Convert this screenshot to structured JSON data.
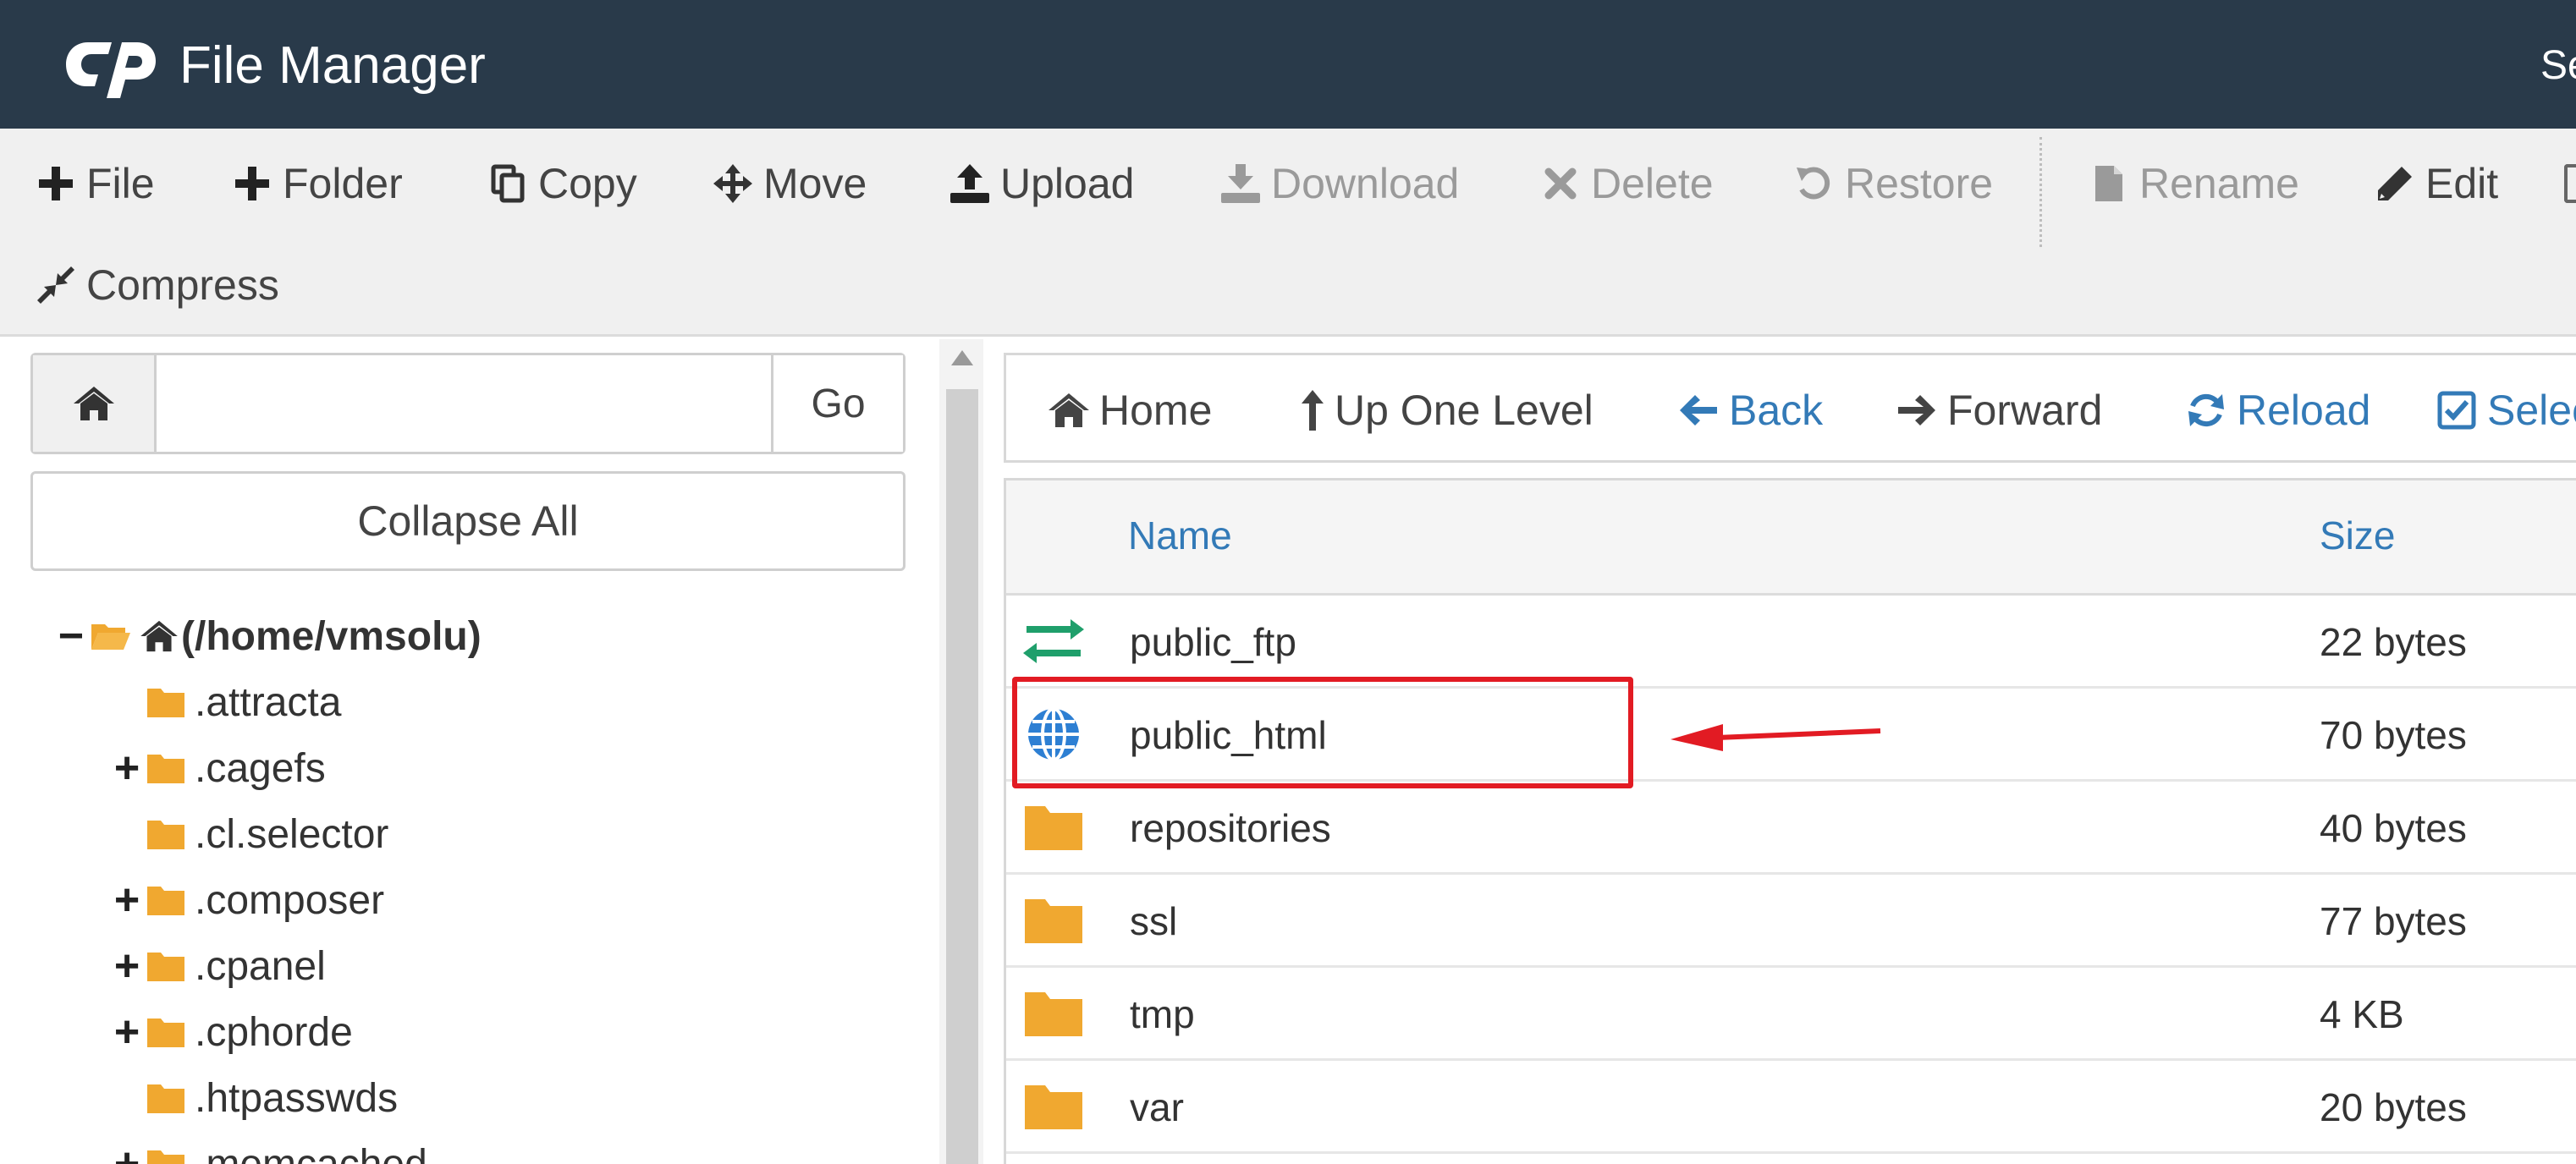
{
  "header": {
    "title": "File Manager",
    "right_text": "Se"
  },
  "toolbar": {
    "row1": [
      {
        "label": "File",
        "icon": "plus-icon",
        "disabled": false
      },
      {
        "label": "Folder",
        "icon": "plus-icon",
        "disabled": false
      },
      {
        "label": "Copy",
        "icon": "copy-icon",
        "disabled": false
      },
      {
        "label": "Move",
        "icon": "move-icon",
        "disabled": false
      },
      {
        "label": "Upload",
        "icon": "upload-icon",
        "disabled": false
      },
      {
        "label": "Download",
        "icon": "download-icon",
        "disabled": true
      },
      {
        "label": "Delete",
        "icon": "delete-icon",
        "disabled": true
      },
      {
        "label": "Restore",
        "icon": "restore-icon",
        "disabled": true
      },
      {
        "label": "Rename",
        "icon": "file-icon",
        "disabled": true
      },
      {
        "label": "Edit",
        "icon": "pencil-icon",
        "disabled": false
      }
    ],
    "row2": [
      {
        "label": "Compress",
        "icon": "compress-icon",
        "disabled": false
      }
    ]
  },
  "left": {
    "path_value": "",
    "go_label": "Go",
    "collapse_label": "Collapse All",
    "tree": [
      {
        "label": "(/home/vmsolu)",
        "toggle": "−",
        "root": true
      },
      {
        "label": ".attracta",
        "toggle": ""
      },
      {
        "label": ".cagefs",
        "toggle": "+"
      },
      {
        "label": ".cl.selector",
        "toggle": ""
      },
      {
        "label": ".composer",
        "toggle": "+"
      },
      {
        "label": ".cpanel",
        "toggle": "+"
      },
      {
        "label": ".cphorde",
        "toggle": "+"
      },
      {
        "label": ".htpasswds",
        "toggle": ""
      },
      {
        "label": ".memcached",
        "toggle": "+"
      }
    ]
  },
  "nav": {
    "home": "Home",
    "up": "Up One Level",
    "back": "Back",
    "forward": "Forward",
    "reload": "Reload",
    "select": "Selec"
  },
  "table": {
    "columns": {
      "name": "Name",
      "size": "Size"
    },
    "rows": [
      {
        "name": "public_ftp",
        "size": "22 bytes",
        "icon": "transfer-arrows-icon"
      },
      {
        "name": "public_html",
        "size": "70 bytes",
        "icon": "globe-icon"
      },
      {
        "name": "repositories",
        "size": "40 bytes",
        "icon": "folder-icon"
      },
      {
        "name": "ssl",
        "size": "77 bytes",
        "icon": "folder-icon"
      },
      {
        "name": "tmp",
        "size": "4 KB",
        "icon": "folder-icon"
      },
      {
        "name": "var",
        "size": "20 bytes",
        "icon": "folder-icon"
      }
    ]
  },
  "colors": {
    "header_bg": "#293a4a",
    "link_blue": "#337ab7",
    "folder_orange": "#f0a830",
    "highlight_red": "#e21b23"
  }
}
